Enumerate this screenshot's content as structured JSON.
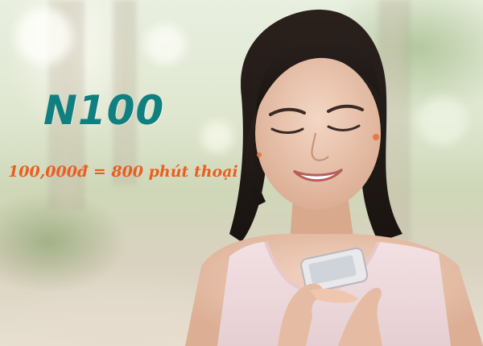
{
  "promo": {
    "package_name": "N100",
    "offer_text": "100,000đ = 800 phút thoại"
  },
  "colors": {
    "heading": "#0f7f80",
    "offer": "#ea5e1f"
  },
  "scene": {
    "image_subject": "woman-smiling-at-phone"
  }
}
